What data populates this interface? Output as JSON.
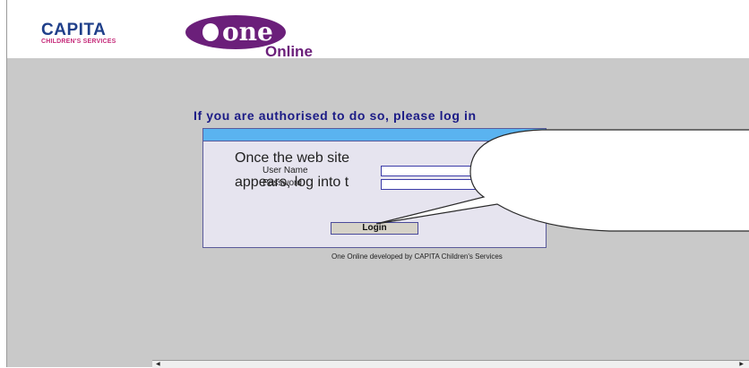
{
  "header": {
    "capita_logo_main": "CAPITA",
    "capita_logo_sub": "CHILDREN'S SERVICES",
    "one_logo_main": "one",
    "one_logo_suffix": "Online"
  },
  "login": {
    "heading": "If you are authorised to do so, please log in",
    "username_label": "User Name",
    "password_label": "Password",
    "username_value": "",
    "password_value": "",
    "login_button": "Login",
    "credit": "One Online developed by CAPITA Children's Services"
  },
  "callout": {
    "line1": "Once the web site",
    "line2": "appears, log into t"
  },
  "scrollbar": {
    "left_arrow": "◀",
    "right_arrow": "▶"
  },
  "colors": {
    "capita_blue": "#1f3f8a",
    "one_purple": "#6b1f7a",
    "heading_navy": "#1b1b86",
    "login_bar_blue": "#5ab3f0",
    "page_gray": "#c9c9c9"
  }
}
